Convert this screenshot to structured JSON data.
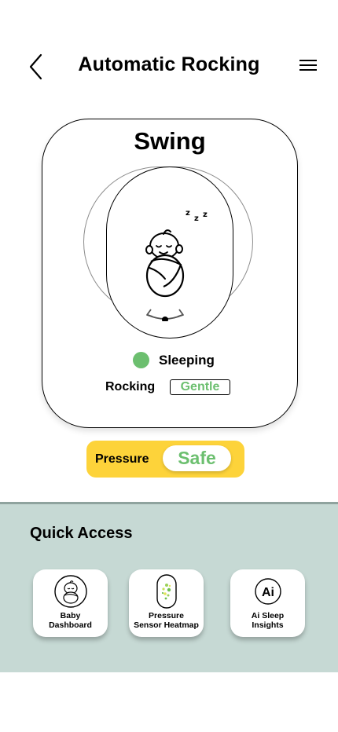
{
  "header": {
    "title": "Automatic Rocking"
  },
  "swing_card": {
    "title": "Swing",
    "sleep_symbol": "z",
    "status_text": "Sleeping",
    "rocking_label": "Rocking",
    "rocking_mode": "Gentle"
  },
  "pressure": {
    "label": "Pressure",
    "value": "Safe"
  },
  "quick_access": {
    "title": "Quick Access",
    "ai_icon_text": "Ai",
    "items": [
      {
        "line1": "Baby",
        "line2": "Dashboard"
      },
      {
        "line1": "Pressure",
        "line2": "Sensor Heatmap"
      },
      {
        "line1": "Ai Sleep",
        "line2": "Insights"
      }
    ]
  },
  "colors": {
    "accent_green": "#6cbf6f",
    "pressure_yellow": "#fdd33a",
    "panel_bg": "#c6d9d4"
  }
}
